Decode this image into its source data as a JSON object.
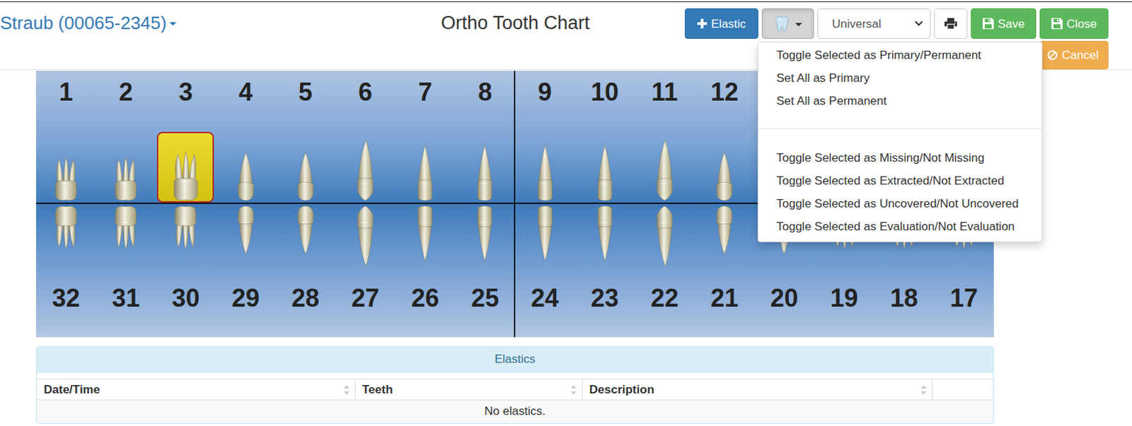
{
  "patient": {
    "label": "Straub (00065-2345)"
  },
  "title": "Ortho Tooth Chart",
  "toolbar": {
    "elastic_button": "Elastic",
    "tooth_menu_open": true,
    "numbering": "Universal",
    "save_button": "Save",
    "close_button": "Close",
    "cancel_button": "Cancel"
  },
  "menu": {
    "groups": [
      {
        "items": [
          {
            "label": "Toggle Selected as Primary/Permanent"
          },
          {
            "label": "Set All as Primary"
          },
          {
            "label": "Set All as Permanent"
          }
        ]
      },
      {
        "items": [
          {
            "label": "Toggle Selected as Missing/Not Missing"
          },
          {
            "label": "Toggle Selected as Extracted/Not Extracted"
          },
          {
            "label": "Toggle Selected as Uncovered/Not Uncovered"
          },
          {
            "label": "Toggle Selected as Evaluation/Not Evaluation"
          }
        ]
      }
    ]
  },
  "chart": {
    "upper": [
      {
        "number": "1",
        "kind": "molar",
        "selected": false
      },
      {
        "number": "2",
        "kind": "molar",
        "selected": false
      },
      {
        "number": "3",
        "kind": "molar",
        "selected": true
      },
      {
        "number": "4",
        "kind": "premolar",
        "selected": false
      },
      {
        "number": "5",
        "kind": "premolar",
        "selected": false
      },
      {
        "number": "6",
        "kind": "canine",
        "selected": false
      },
      {
        "number": "7",
        "kind": "incisor",
        "selected": false
      },
      {
        "number": "8",
        "kind": "incisor",
        "selected": false
      },
      {
        "number": "9",
        "kind": "incisor",
        "selected": false
      },
      {
        "number": "10",
        "kind": "incisor",
        "selected": false
      },
      {
        "number": "11",
        "kind": "canine",
        "selected": false
      },
      {
        "number": "12",
        "kind": "premolar",
        "selected": false
      },
      {
        "kind": "premolar",
        "selected": false
      },
      {
        "kind": "molar",
        "selected": false
      },
      {
        "kind": "molar",
        "selected": false
      },
      {
        "kind": "molar",
        "selected": false
      }
    ],
    "lower": [
      {
        "number": "32",
        "kind": "molar",
        "selected": false
      },
      {
        "number": "31",
        "kind": "molar",
        "selected": false
      },
      {
        "number": "30",
        "kind": "molar",
        "selected": false
      },
      {
        "number": "29",
        "kind": "premolar",
        "selected": false
      },
      {
        "number": "28",
        "kind": "premolar",
        "selected": false
      },
      {
        "number": "27",
        "kind": "canine",
        "selected": false
      },
      {
        "number": "26",
        "kind": "incisor",
        "selected": false
      },
      {
        "number": "25",
        "kind": "incisor",
        "selected": false
      },
      {
        "number": "24",
        "kind": "incisor",
        "selected": false
      },
      {
        "number": "23",
        "kind": "incisor",
        "selected": false
      },
      {
        "number": "22",
        "kind": "canine",
        "selected": false
      },
      {
        "number": "21",
        "kind": "premolar",
        "selected": false
      },
      {
        "number": "20",
        "kind": "premolar",
        "selected": false
      },
      {
        "number": "19",
        "kind": "molar",
        "selected": false
      },
      {
        "number": "18",
        "kind": "molar",
        "selected": false
      },
      {
        "number": "17",
        "kind": "molar",
        "selected": false
      }
    ]
  },
  "elastics": {
    "title": "Elastics",
    "columns": [
      "Date/Time",
      "Teeth",
      "Description"
    ],
    "empty_message": "No elastics."
  }
}
